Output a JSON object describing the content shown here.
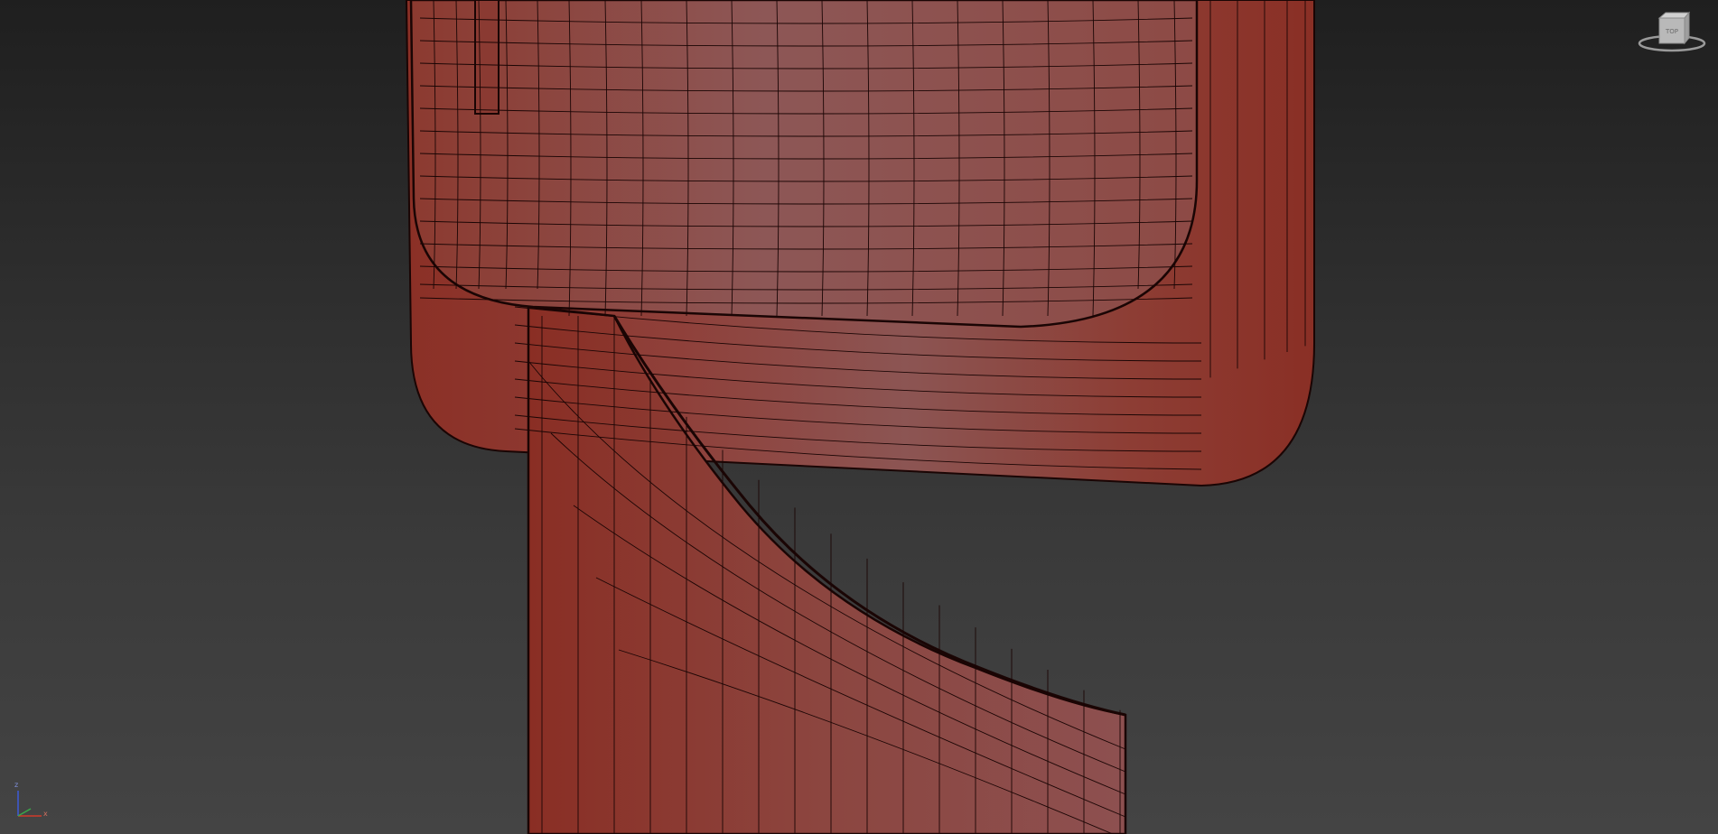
{
  "viewport": {
    "background_top": "#1f1f1f",
    "background_bottom": "#444444",
    "mesh_color": "#8d3d35",
    "mesh_highlight": "#8c5553",
    "wire_color": "#1a0504"
  },
  "viewcube": {
    "face_label": "TOP",
    "face_color": "#b9b9b9",
    "ring_color": "#9a9a9a"
  },
  "axis_gizmo": {
    "z_label": "z",
    "x_label": "x",
    "z_color": "#3d5bd8",
    "x_color": "#d03a2a",
    "y_color": "#3aa84a"
  }
}
